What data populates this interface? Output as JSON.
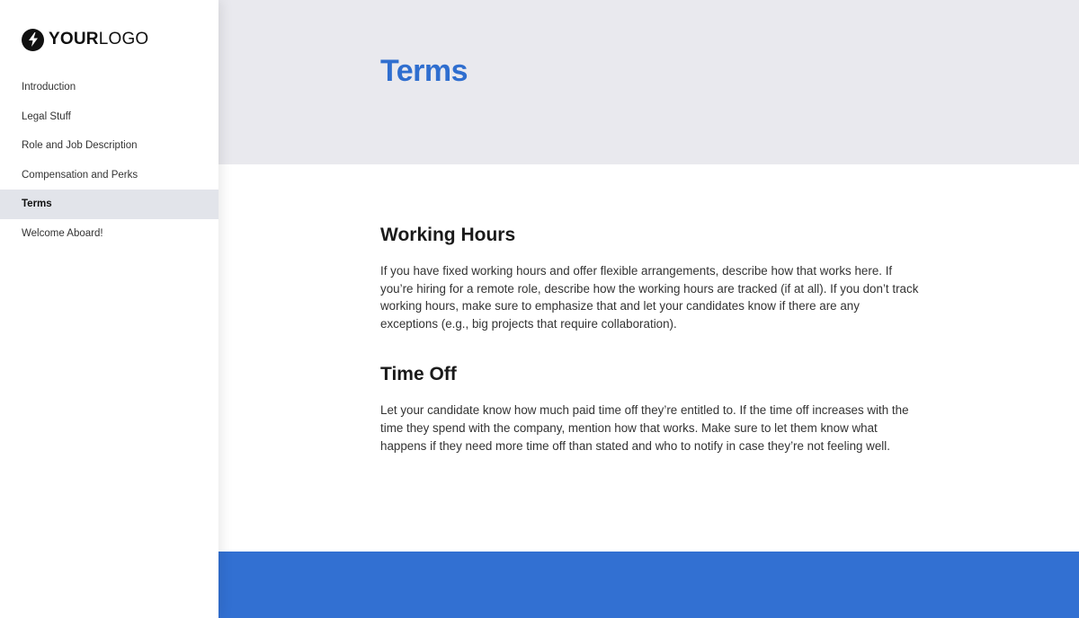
{
  "brand": {
    "logo_bold": "YOUR",
    "logo_light": "LOGO",
    "icon": "lightning-bolt-icon"
  },
  "sidebar": {
    "items": [
      {
        "label": "Introduction",
        "active": false
      },
      {
        "label": "Legal Stuff",
        "active": false
      },
      {
        "label": "Role and Job Description",
        "active": false
      },
      {
        "label": "Compensation and Perks",
        "active": false
      },
      {
        "label": "Terms",
        "active": true
      },
      {
        "label": "Welcome Aboard!",
        "active": false
      }
    ]
  },
  "header": {
    "title": "Terms"
  },
  "sections": [
    {
      "title": "Working Hours",
      "body": "If you have fixed working hours and offer flexible arrangements, describe how that works here. If you’re hiring for a remote role, describe how the working hours are tracked (if at all). If you don’t track working hours, make sure to emphasize that and let your candidates know if there are any exceptions (e.g., big projects that require collaboration)."
    },
    {
      "title": "Time Off",
      "body": "Let your candidate know how much paid time off they’re entitled to. If the time off increases with the time they spend with the company, mention how that works. Make sure to let them know what happens if they need more time off than stated and who to notify in case they’re not feeling well."
    }
  ],
  "colors": {
    "accent": "#2f6ecf",
    "footer": "#3270d2",
    "hero_bg": "#e9e9ee",
    "active_nav_bg": "#e2e4ea"
  }
}
